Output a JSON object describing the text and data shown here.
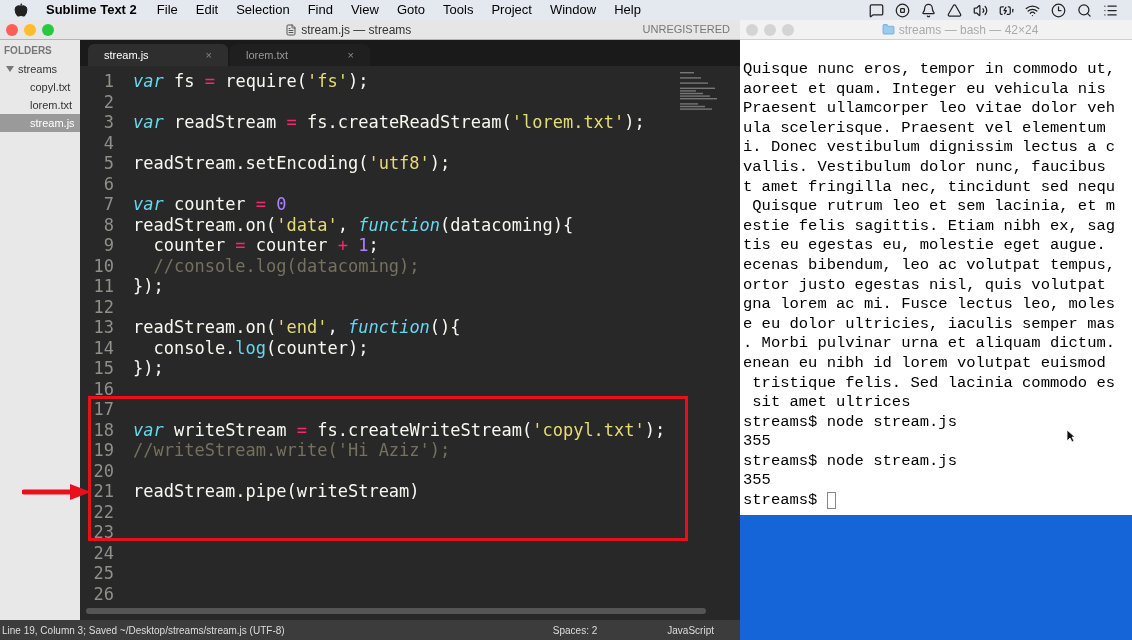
{
  "menu_bar": {
    "app_name": "Sublime Text 2",
    "items": [
      "File",
      "Edit",
      "Selection",
      "Find",
      "View",
      "Goto",
      "Tools",
      "Project",
      "Window",
      "Help"
    ]
  },
  "editor_window": {
    "title": "stream.js — streams",
    "license": "UNREGISTERED",
    "sidebar": {
      "heading": "FOLDERS",
      "tree": [
        {
          "label": "streams",
          "expanded": true,
          "selected": false,
          "children": [
            {
              "label": "copyl.txt",
              "selected": false
            },
            {
              "label": "lorem.txt",
              "selected": false
            },
            {
              "label": "stream.js",
              "selected": true
            }
          ]
        }
      ]
    },
    "tabs": [
      {
        "label": "stream.js",
        "selected": true,
        "close": "×"
      },
      {
        "label": "lorem.txt",
        "selected": false,
        "close": "×"
      }
    ],
    "code_lines": [
      {
        "number": "1",
        "tokens": [
          {
            "text": "var",
            "kind": "keyword"
          },
          {
            "text": " fs ",
            "kind": "plain"
          },
          {
            "text": "=",
            "kind": "operator"
          },
          {
            "text": " require(",
            "kind": "plain"
          },
          {
            "text": "'fs'",
            "kind": "string"
          },
          {
            "text": ");",
            "kind": "plain"
          }
        ]
      },
      {
        "number": "2"
      },
      {
        "number": "3",
        "tokens": [
          {
            "text": "var",
            "kind": "keyword"
          },
          {
            "text": " readStream ",
            "kind": "plain"
          },
          {
            "text": "=",
            "kind": "operator"
          },
          {
            "text": " fs.createReadStream(",
            "kind": "plain"
          },
          {
            "text": "'lorem.txt'",
            "kind": "string"
          },
          {
            "text": ");",
            "kind": "plain"
          }
        ]
      },
      {
        "number": "4"
      },
      {
        "number": "5",
        "tokens": [
          {
            "text": "readStream.setEncoding(",
            "kind": "plain"
          },
          {
            "text": "'utf8'",
            "kind": "string"
          },
          {
            "text": ");",
            "kind": "plain"
          }
        ]
      },
      {
        "number": "6"
      },
      {
        "number": "7",
        "tokens": [
          {
            "text": "var",
            "kind": "keyword"
          },
          {
            "text": " counter ",
            "kind": "plain"
          },
          {
            "text": "= ",
            "kind": "operator"
          },
          {
            "text": "0",
            "kind": "number"
          }
        ]
      },
      {
        "number": "8",
        "tokens": [
          {
            "text": "readStream.on(",
            "kind": "plain"
          },
          {
            "text": "'data'",
            "kind": "string"
          },
          {
            "text": ", ",
            "kind": "plain"
          },
          {
            "text": "function",
            "kind": "keyword"
          },
          {
            "text": "(datacoming){",
            "kind": "plain"
          }
        ]
      },
      {
        "number": "9",
        "tokens": [
          {
            "text": "  counter ",
            "kind": "plain"
          },
          {
            "text": "=",
            "kind": "operator"
          },
          {
            "text": " counter ",
            "kind": "plain"
          },
          {
            "text": "+ ",
            "kind": "operator"
          },
          {
            "text": "1",
            "kind": "number"
          },
          {
            "text": ";",
            "kind": "plain"
          }
        ]
      },
      {
        "number": "10",
        "tokens": [
          {
            "text": "  //console.log(datacoming);",
            "kind": "comment"
          }
        ]
      },
      {
        "number": "11",
        "tokens": [
          {
            "text": "});",
            "kind": "plain"
          }
        ]
      },
      {
        "number": "12"
      },
      {
        "number": "13",
        "tokens": [
          {
            "text": "readStream.on(",
            "kind": "plain"
          },
          {
            "text": "'end'",
            "kind": "string"
          },
          {
            "text": ", ",
            "kind": "plain"
          },
          {
            "text": "function",
            "kind": "keyword"
          },
          {
            "text": "(){",
            "kind": "plain"
          }
        ]
      },
      {
        "number": "14",
        "tokens": [
          {
            "text": "  console.",
            "kind": "plain"
          },
          {
            "text": "log",
            "kind": "call"
          },
          {
            "text": "(counter);",
            "kind": "plain"
          }
        ]
      },
      {
        "number": "15",
        "tokens": [
          {
            "text": "});",
            "kind": "plain"
          }
        ]
      },
      {
        "number": "16"
      },
      {
        "number": "17"
      },
      {
        "number": "18",
        "tokens": [
          {
            "text": "var",
            "kind": "keyword"
          },
          {
            "text": " writeStream ",
            "kind": "plain"
          },
          {
            "text": "=",
            "kind": "operator"
          },
          {
            "text": " fs.createWriteStream(",
            "kind": "plain"
          },
          {
            "text": "'copyl.txt'",
            "kind": "string"
          },
          {
            "text": ");",
            "kind": "plain"
          }
        ]
      },
      {
        "number": "19",
        "tokens": [
          {
            "text": "//writeStream.write('Hi Aziz');",
            "kind": "comment"
          }
        ]
      },
      {
        "number": "20"
      },
      {
        "number": "21",
        "tokens": [
          {
            "text": "readStream.pipe(writeStream)",
            "kind": "plain"
          }
        ]
      },
      {
        "number": "22"
      },
      {
        "number": "23"
      },
      {
        "number": "24"
      },
      {
        "number": "25"
      },
      {
        "number": "26"
      }
    ],
    "status_bar": {
      "position": "Line 19, Column 3; Saved ~/Desktop/streams/stream.js (UTF-8)",
      "indentation": "Spaces: 2",
      "syntax": "JavaScript"
    }
  },
  "terminal_window": {
    "title": "streams — bash — 42×24",
    "lines": [
      "Quisque nunc eros, tempor in commodo ut,",
      "aoreet et quam. Integer eu vehicula nis",
      "Praesent ullamcorper leo vitae dolor veh",
      "ula scelerisque. Praesent vel elementum",
      "i. Donec vestibulum dignissim lectus a c",
      "vallis. Vestibulum dolor nunc, faucibus",
      "t amet fringilla nec, tincidunt sed nequ",
      " Quisque rutrum leo et sem lacinia, et m",
      "estie felis sagittis. Etiam nibh ex, sag",
      "tis eu egestas eu, molestie eget augue.",
      "ecenas bibendum, leo ac volutpat tempus,",
      "ortor justo egestas nisl, quis volutpat",
      "gna lorem ac mi. Fusce lectus leo, moles",
      "e eu dolor ultricies, iaculis semper mas",
      ". Morbi pulvinar urna et aliquam dictum.",
      "enean eu nibh id lorem volutpat euismod",
      " tristique felis. Sed lacinia commodo es",
      " sit amet ultrices",
      "streams$ node stream.js",
      "355",
      "streams$ node stream.js",
      "355"
    ],
    "prompt": "streams$ "
  }
}
